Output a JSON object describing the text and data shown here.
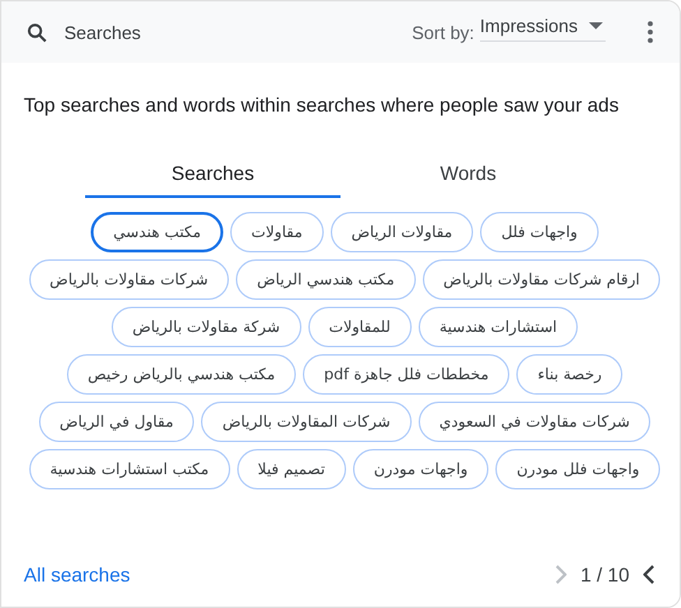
{
  "header": {
    "search_placeholder": "Searches",
    "sort_label": "Sort by:",
    "sort_value": "Impressions"
  },
  "description": "Top searches and words within searches where people saw your ads",
  "tabs": {
    "searches_tab": {
      "label": "Searches",
      "selected": true
    },
    "words_tab": {
      "label": "Words",
      "selected": false
    }
  },
  "chip_rows": [
    [
      {
        "label": "واجهات فلل",
        "selected": false
      },
      {
        "label": "مقاولات الرياض",
        "selected": false
      },
      {
        "label": "مقاولات",
        "selected": false
      },
      {
        "label": "مكتب هندسي",
        "selected": true
      }
    ],
    [
      {
        "label": "ارقام شركات مقاولات بالرياض",
        "selected": false
      },
      {
        "label": "مكتب هندسي الرياض",
        "selected": false
      },
      {
        "label": "شركات مقاولات بالرياض",
        "selected": false
      }
    ],
    [
      {
        "label": "استشارات هندسية",
        "selected": false
      },
      {
        "label": "للمقاولات",
        "selected": false
      },
      {
        "label": "شركة مقاولات بالرياض",
        "selected": false
      }
    ],
    [
      {
        "label": "رخصة بناء",
        "selected": false
      },
      {
        "label": "مخططات فلل جاهزة pdf",
        "selected": false
      },
      {
        "label": "مكتب هندسي بالرياض رخيص",
        "selected": false
      }
    ],
    [
      {
        "label": "شركات مقاولات في السعودي",
        "selected": false
      },
      {
        "label": "شركات المقاولات بالرياض",
        "selected": false
      },
      {
        "label": "مقاول في الرياض",
        "selected": false
      }
    ],
    [
      {
        "label": "واجهات فلل مودرن",
        "selected": false
      },
      {
        "label": "واجهات مودرن",
        "selected": false
      },
      {
        "label": "تصميم فيلا",
        "selected": false
      },
      {
        "label": "مكتب استشارات هندسية",
        "selected": false
      }
    ]
  ],
  "footer": {
    "link": "All searches",
    "page": "1 / 10",
    "next_disabled": true,
    "prev_disabled": false
  }
}
